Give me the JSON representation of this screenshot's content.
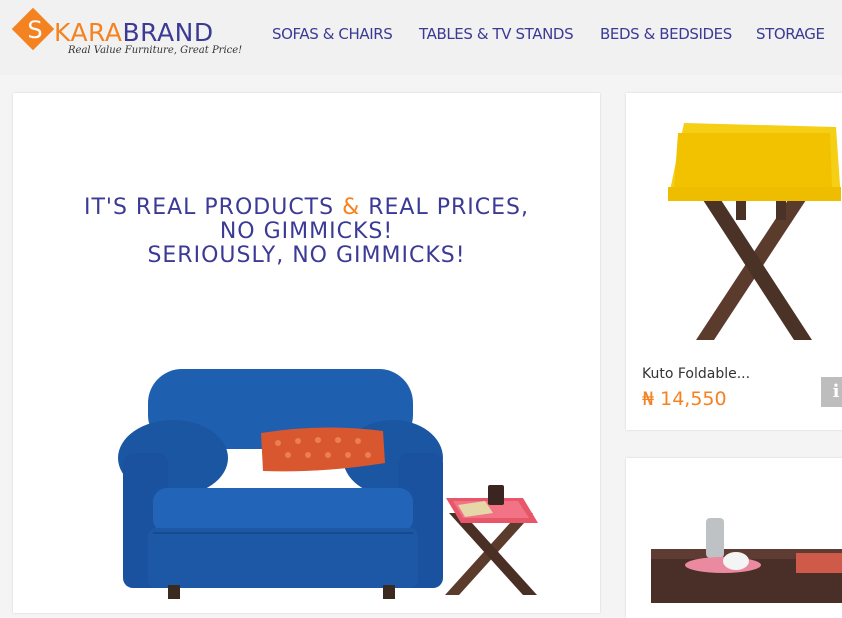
{
  "logo": {
    "brand_part1": "KARA",
    "brand_part2": "BRAND",
    "s_letter": "S",
    "tagline": "Real Value Furniture, Great Price!"
  },
  "nav": {
    "items": [
      {
        "label": "SOFAS & CHAIRS"
      },
      {
        "label": "TABLES & TV STANDS"
      },
      {
        "label": "BEDS & BEDSIDES"
      },
      {
        "label": "STORAGE"
      }
    ]
  },
  "hero": {
    "line1_a": "IT'S REAL PRODUCTS",
    "line1_amp": "&",
    "line1_b": "REAL PRICES,",
    "line2": "NO GIMMICKS!",
    "line3": "SERIOUSLY, NO GIMMICKS!"
  },
  "products": [
    {
      "name": "Kuto Foldable...",
      "price": "₦ 14,550",
      "info_icon": "i"
    }
  ],
  "colors": {
    "brand_blue": "#3b3a95",
    "brand_orange": "#f58220",
    "sofa_blue": "#1f5fb0"
  }
}
